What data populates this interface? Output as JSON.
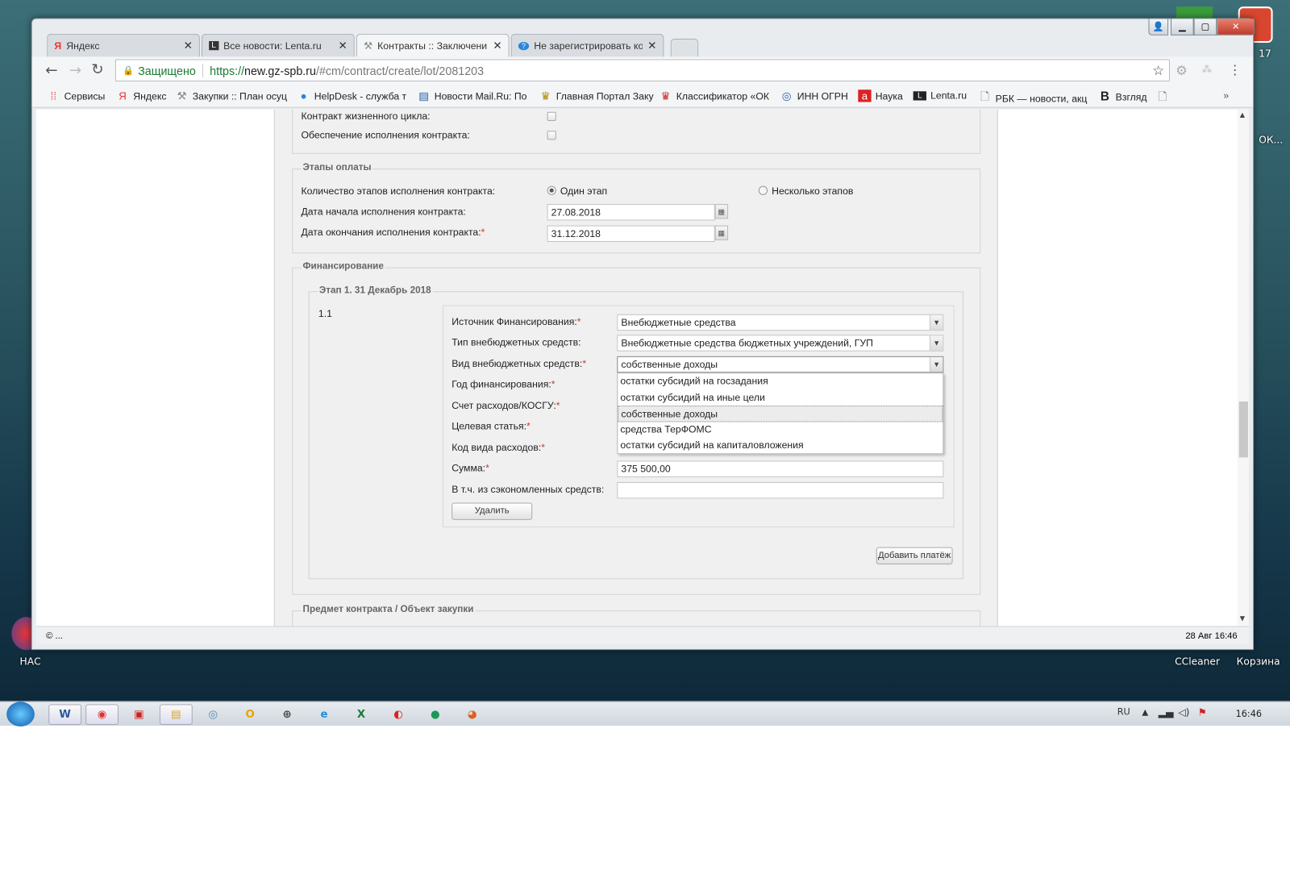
{
  "desktop": {
    "icons": [
      {
        "label": "НАС"
      },
      {
        "label": "CCleaner"
      },
      {
        "label": "Корзина"
      },
      {
        "label": "ОК..."
      },
      {
        "label": "17"
      }
    ]
  },
  "browser": {
    "tabs": [
      {
        "label": "Яндекс",
        "icon": "yandex-icon",
        "active": false
      },
      {
        "label": "Все новости: Lenta.ru",
        "icon": "lenta-icon",
        "active": false
      },
      {
        "label": "Контракты :: Заключени",
        "icon": "hammer-icon",
        "active": true
      },
      {
        "label": "Не зарегистрировать ко",
        "icon": "help-icon",
        "active": false
      }
    ],
    "secure_label": "Защищено",
    "url_scheme": "https://",
    "url_host": "new.gz-spb.ru",
    "url_path": "/#cm/contract/create/lot/2081203",
    "bookmarks": [
      {
        "label": "Сервисы",
        "icon": "apps-icon"
      },
      {
        "label": "Яндекс",
        "icon": "yandex-icon"
      },
      {
        "label": "Закупки :: План осуц",
        "icon": "hammer-icon"
      },
      {
        "label": "HelpDesk - служба т",
        "icon": "help-icon"
      },
      {
        "label": "Новости Mail.Ru: По",
        "icon": "mail-news-icon"
      },
      {
        "label": "Главная Портал Заку",
        "icon": "emblem-icon"
      },
      {
        "label": "Классификатор «ОК",
        "icon": "emblem-icon"
      },
      {
        "label": "ИНН ОГРН",
        "icon": "tax-icon"
      },
      {
        "label": "Наука",
        "icon": "nauka-icon"
      },
      {
        "label": "Lenta.ru",
        "icon": "lenta-icon"
      },
      {
        "label": "РБК — новости, акц",
        "icon": "page-icon"
      },
      {
        "label": "Взгляд",
        "icon": "vzglyad-icon"
      },
      {
        "label": "",
        "icon": "page-icon"
      }
    ],
    "more_bookmarks": "»",
    "status_left": "© ...",
    "status_right": "28 Авг 16:46"
  },
  "form": {
    "top": {
      "life_cycle_label": "Контракт жизненного цикла:",
      "life_cycle_checked": false,
      "security_label": "Обеспечение исполнения контракта:",
      "security_checked": false
    },
    "payment_stages": {
      "legend": "Этапы оплаты",
      "count_label": "Количество этапов исполнения контракта:",
      "option_one": "Один этап",
      "option_many": "Несколько этапов",
      "selected": "Один этап",
      "start_label": "Дата начала исполнения контракта:",
      "start_value": "27.08.2018",
      "end_label": "Дата окончания исполнения контракта:",
      "end_value": "31.12.2018"
    },
    "financing": {
      "legend": "Финансирование",
      "stage_legend": "Этап 1. 31 Декабрь 2018",
      "item_number": "1.1",
      "source_label": "Источник Финансирования:",
      "source_value": "Внебюджетные средства",
      "type_label": "Тип внебюджетных средств:",
      "type_value": "Внебюджетные средства бюджетных учреждений, ГУП",
      "kind_label": "Вид внебюджетных средств:",
      "kind_value": "собственные доходы",
      "kind_options": [
        "остатки субсидий на госзадания",
        "остатки субсидий на иные цели",
        "собственные доходы",
        "средства ТерФОМС",
        "остатки субсидий на капиталовложения"
      ],
      "year_label": "Год финансирования:",
      "account_label": "Счет расходов/КОСГУ:",
      "target_label": "Целевая статья:",
      "expense_code_label": "Код вида расходов:",
      "sum_label": "Сумма:",
      "sum_value": "375 500,00",
      "saved_label": "В т.ч. из сэкономленных средств:",
      "saved_value": "",
      "delete_button": "Удалить",
      "add_payment_button": "Добавить платёж"
    },
    "subject": {
      "legend": "Предмет контракта / Объект закупки"
    },
    "required_mark": "*"
  },
  "taskbar": {
    "lang": "RU",
    "clock": "16:46",
    "apps": [
      "word-icon",
      "chrome-icon",
      "pdf-icon",
      "explorer-icon",
      "network-icon",
      "outlook-icon",
      "globe-icon",
      "ie-icon",
      "excel-icon",
      "acrobat-icon",
      "app-icon",
      "firefox-icon"
    ]
  }
}
